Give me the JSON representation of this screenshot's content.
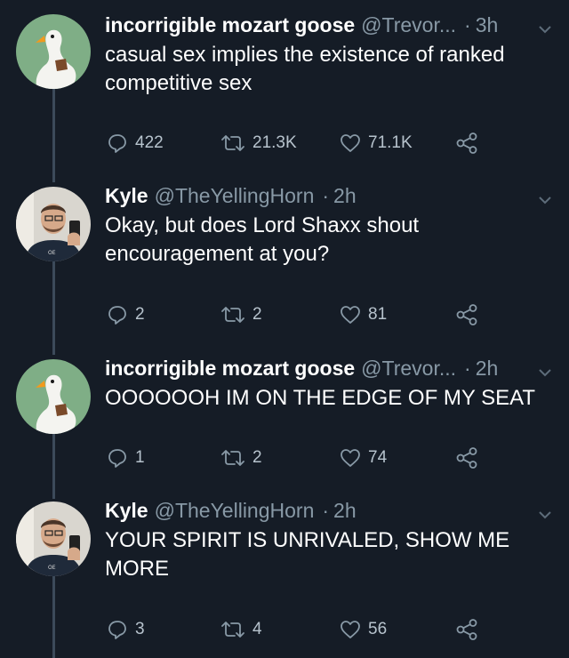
{
  "colors": {
    "background": "#151c26",
    "text": "#ffffff",
    "muted": "#8899a6",
    "thread_line": "#3c4a5a"
  },
  "tweets": [
    {
      "author": "incorrigible mozart goose",
      "handle": "@Trevor...",
      "separator": "·",
      "time": "3h",
      "avatar": "goose-avatar",
      "text": "casual sex implies the existence of ranked competitive sex",
      "replies": "422",
      "retweets": "21.3K",
      "likes": "71.1K"
    },
    {
      "author": "Kyle",
      "handle": "@TheYellingHorn",
      "separator": "·",
      "time": "2h",
      "avatar": "person-avatar",
      "text": "Okay, but does Lord Shaxx shout encouragement at you?",
      "replies": "2",
      "retweets": "2",
      "likes": "81"
    },
    {
      "author": "incorrigible mozart goose",
      "handle": "@Trevor...",
      "separator": "·",
      "time": "2h",
      "avatar": "goose-avatar",
      "text": "OOOOOOH IM ON THE EDGE OF MY SEAT",
      "replies": "1",
      "retweets": "2",
      "likes": "74"
    },
    {
      "author": "Kyle",
      "handle": "@TheYellingHorn",
      "separator": "·",
      "time": "2h",
      "avatar": "person-avatar",
      "text": "YOUR SPIRIT IS UNRIVALED, SHOW ME MORE",
      "replies": "3",
      "retweets": "4",
      "likes": "56"
    }
  ]
}
